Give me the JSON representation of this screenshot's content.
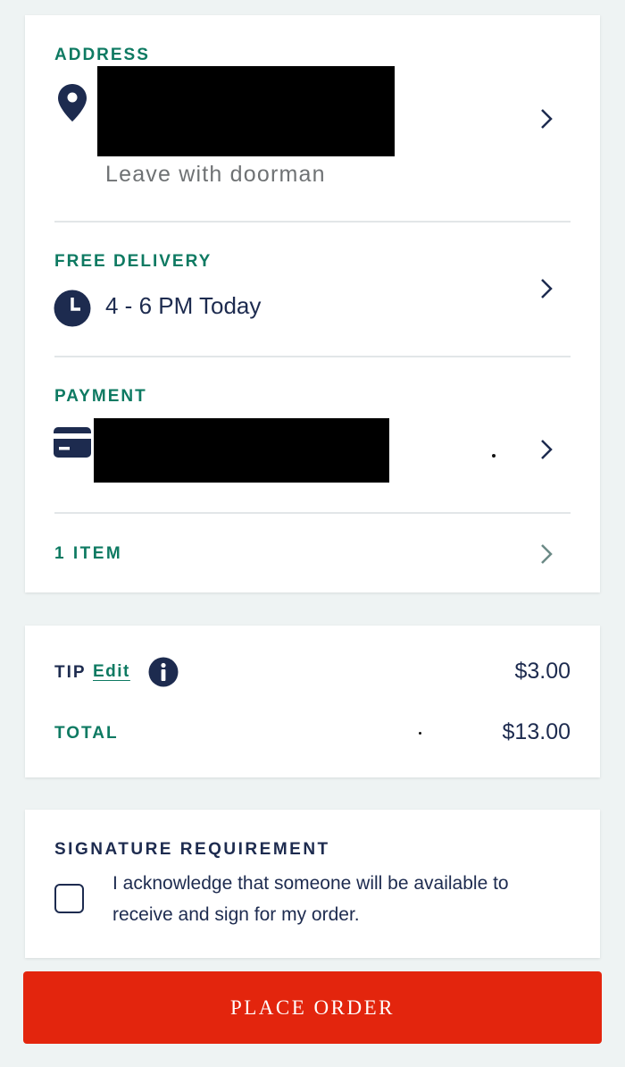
{
  "address": {
    "label": "ADDRESS",
    "note": "Leave with doorman",
    "icon": "map-pin-icon"
  },
  "delivery": {
    "label": "FREE DELIVERY",
    "window": "4 - 6 PM Today",
    "icon": "clock-icon"
  },
  "payment": {
    "label": "PAYMENT",
    "icon": "credit-card-icon"
  },
  "items": {
    "label": "1 ITEM"
  },
  "totals": {
    "tip_label": "TIP",
    "tip_edit": "Edit",
    "tip_value": "$3.00",
    "total_label": "TOTAL",
    "total_value": "$13.00"
  },
  "signature": {
    "heading": "SIGNATURE REQUIREMENT",
    "line1": "I acknowledge that someone will be available to",
    "line2": "receive and sign for my order.",
    "checked": false
  },
  "actions": {
    "place_order": "PLACE ORDER"
  },
  "colors": {
    "brand_green": "#0e7a62",
    "navy": "#1d2b4f",
    "button_red": "#e3250d",
    "page_bg": "#eef3f3"
  }
}
